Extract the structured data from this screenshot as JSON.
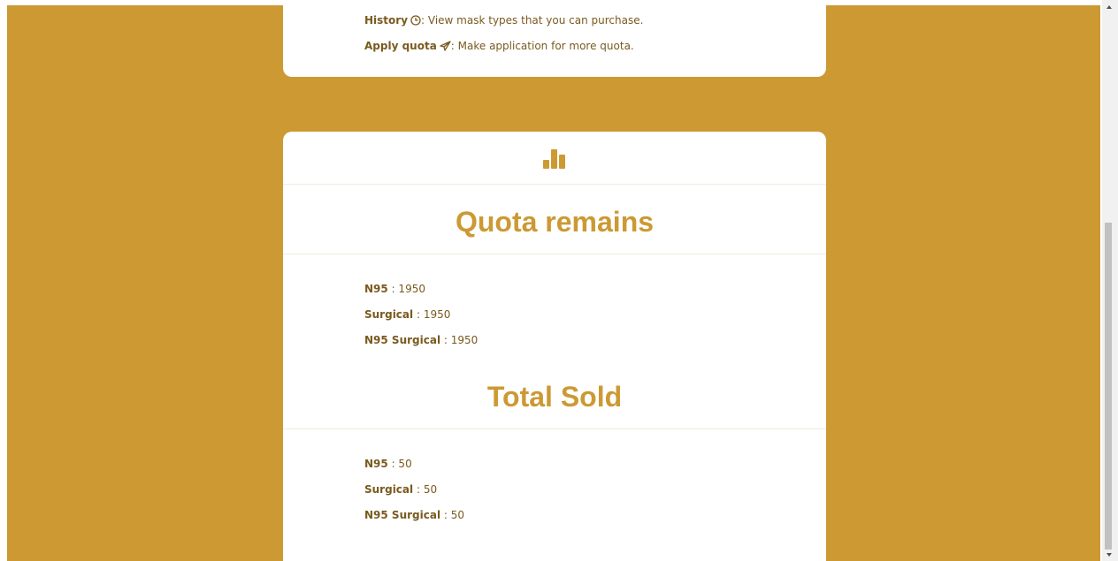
{
  "colors": {
    "page_background": "#cc9933",
    "card_background": "#ffffff",
    "heading": "#cc9933",
    "body_text": "#7a5a1e"
  },
  "intro": {
    "history_label": "History",
    "history_text": ": View mask types that you can purchase.",
    "apply_label": "Apply quota",
    "apply_text": ": Make application for more quota."
  },
  "icons": {
    "history": "clock-icon",
    "apply": "paper-plane-icon",
    "stats": "bar-chart-icon"
  },
  "quota_remains": {
    "title": "Quota remains",
    "items": [
      {
        "label": "N95",
        "value": ": 1950"
      },
      {
        "label": "Surgical",
        "value": ": 1950"
      },
      {
        "label": "N95 Surgical",
        "value": ": 1950"
      }
    ]
  },
  "total_sold": {
    "title": "Total Sold",
    "items": [
      {
        "label": "N95",
        "value": ": 50"
      },
      {
        "label": "Surgical",
        "value": ": 50"
      },
      {
        "label": "N95 Surgical",
        "value": ": 50"
      }
    ]
  }
}
